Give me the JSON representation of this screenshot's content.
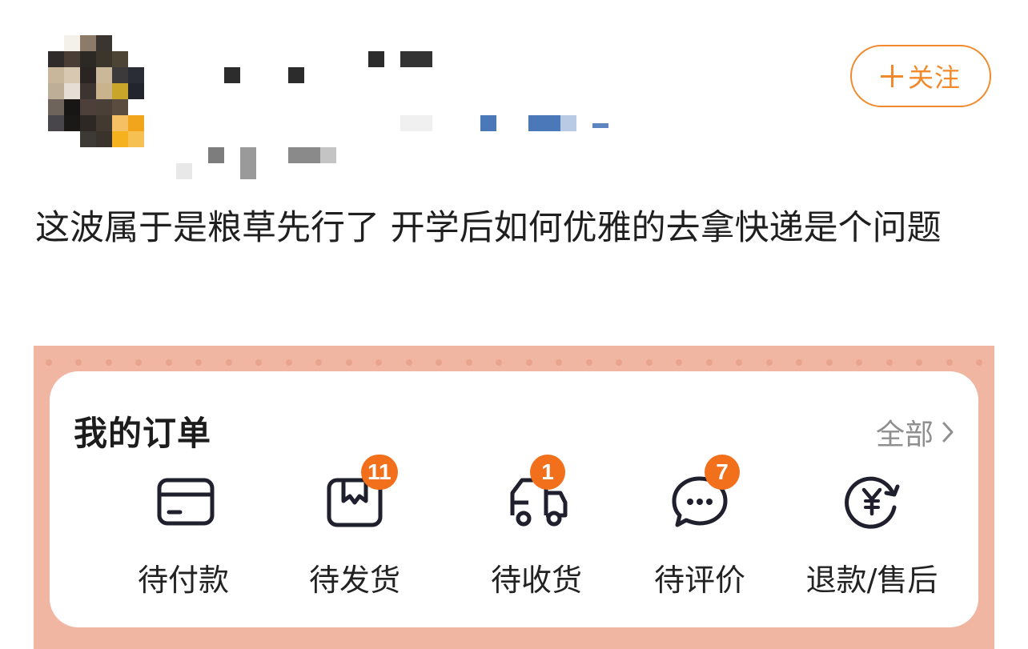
{
  "post": {
    "follow_label": "关注",
    "text": "这波属于是粮草先行了 开学后如何优雅的去拿快递是个问题"
  },
  "orders": {
    "title": "我的订单",
    "view_all_label": "全部",
    "statuses": [
      {
        "label": "待付款",
        "icon": "card-icon"
      },
      {
        "label": "待发货",
        "icon": "package-icon",
        "badge": "11"
      },
      {
        "label": "待收货",
        "icon": "truck-icon",
        "badge": "1"
      },
      {
        "label": "待评价",
        "icon": "chat-icon",
        "badge": "7"
      },
      {
        "label": "退款/售后",
        "icon": "refund-yuan-icon"
      }
    ]
  },
  "colors": {
    "accent": "#f08a2c",
    "badge": "#f2701c",
    "frame_background": "#f0b6a2",
    "muted_text": "#8f8f8f"
  }
}
